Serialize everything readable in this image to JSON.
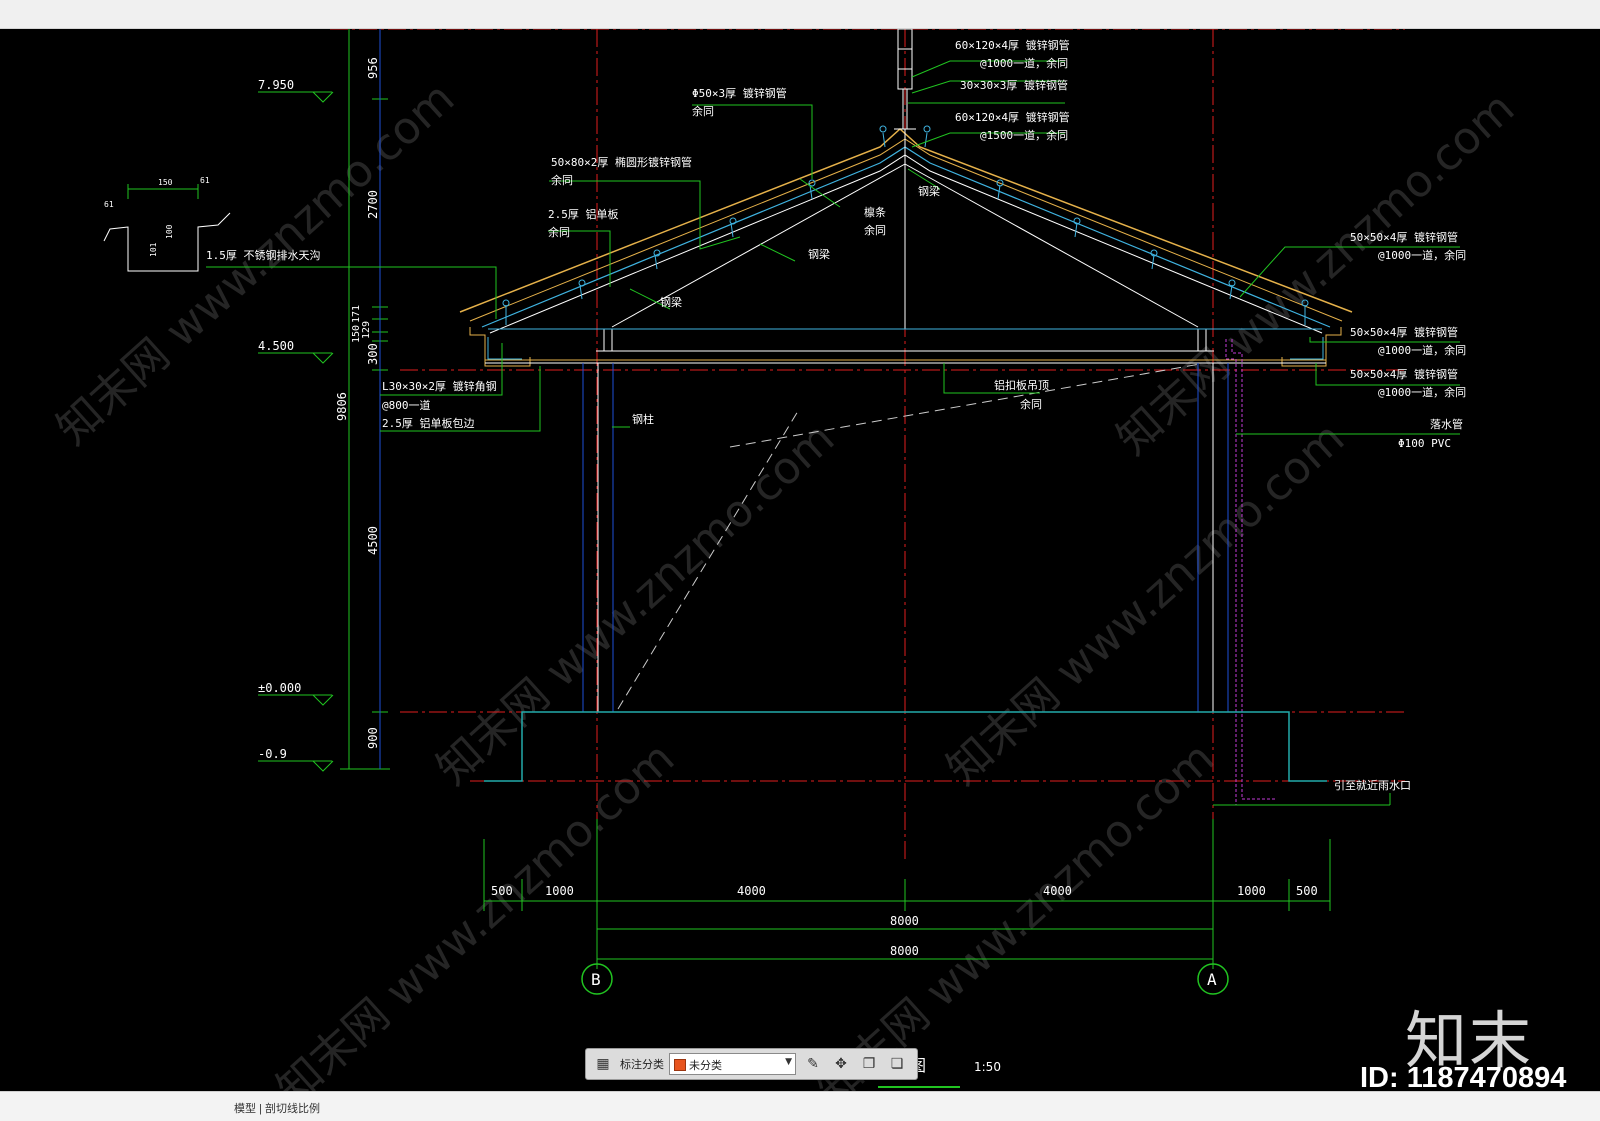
{
  "statusbar": {
    "text": "模型 | 剖切线比例"
  },
  "watermark": {
    "text": "知末网 www.znzmo.com",
    "logo": "知末",
    "id": "ID: 1187470894"
  },
  "toolbar": {
    "grid_icon": "grid-icon",
    "label": "标注分类",
    "select_value": "未分类",
    "icons": [
      "edit-icon",
      "move-icon",
      "copy-icon",
      "paste-icon"
    ]
  },
  "drawing": {
    "title": "剖面图",
    "scale": "1:50",
    "elevations": [
      "7.950",
      "4.500",
      "±0.000",
      "-0.9"
    ],
    "vertical_dims": [
      "956",
      "2700",
      "150",
      "171",
      "129",
      "300",
      "9806",
      "4500",
      "900"
    ],
    "gutter_detail": {
      "dims": [
        "150",
        "61",
        "61",
        "101",
        "100"
      ]
    },
    "horizontal_dims": [
      "500",
      "1000",
      "4000",
      "4000",
      "1000",
      "500"
    ],
    "span_dims": [
      "8000",
      "8000"
    ],
    "axes": [
      "B",
      "A"
    ],
    "callouts": {
      "c1": [
        "60×120×4厚 镀锌钢管",
        "@1000一道，余同"
      ],
      "c2": [
        "30×30×3厚 镀锌钢管"
      ],
      "c3": [
        "60×120×4厚 镀锌钢管",
        "@1500一道，余同"
      ],
      "c4": [
        "Φ50×3厚 镀锌钢管",
        "余同"
      ],
      "c5": [
        "50×80×2厚 椭圆形镀锌钢管",
        "余同"
      ],
      "c6": [
        "2.5厚 铝单板",
        "余同"
      ],
      "c7": [
        "1.5厚 不锈钢排水天沟"
      ],
      "c8": [
        "L30×30×2厚 镀锌角钢",
        "@800一道"
      ],
      "c9": [
        "2.5厚 铝单板包边"
      ],
      "c10": [
        "50×50×4厚 镀锌钢管",
        "@1000一道，余同"
      ],
      "c11": [
        "50×50×4厚 镀锌钢管",
        "@1000一道，余同"
      ],
      "c12": [
        "50×50×4厚 镀锌钢管",
        "@1000一道，余同"
      ],
      "c13": [
        "落水管",
        "Φ100 PVC"
      ],
      "c14": [
        "引至就近雨水口"
      ],
      "c15": [
        "铝扣板吊顶",
        "余同"
      ],
      "c16": [
        "檩条",
        "余同"
      ],
      "beam1": "钢梁",
      "beam2": "钢梁",
      "beam3": "钢梁",
      "beam4": "钢梁",
      "column": "钢柱"
    }
  }
}
